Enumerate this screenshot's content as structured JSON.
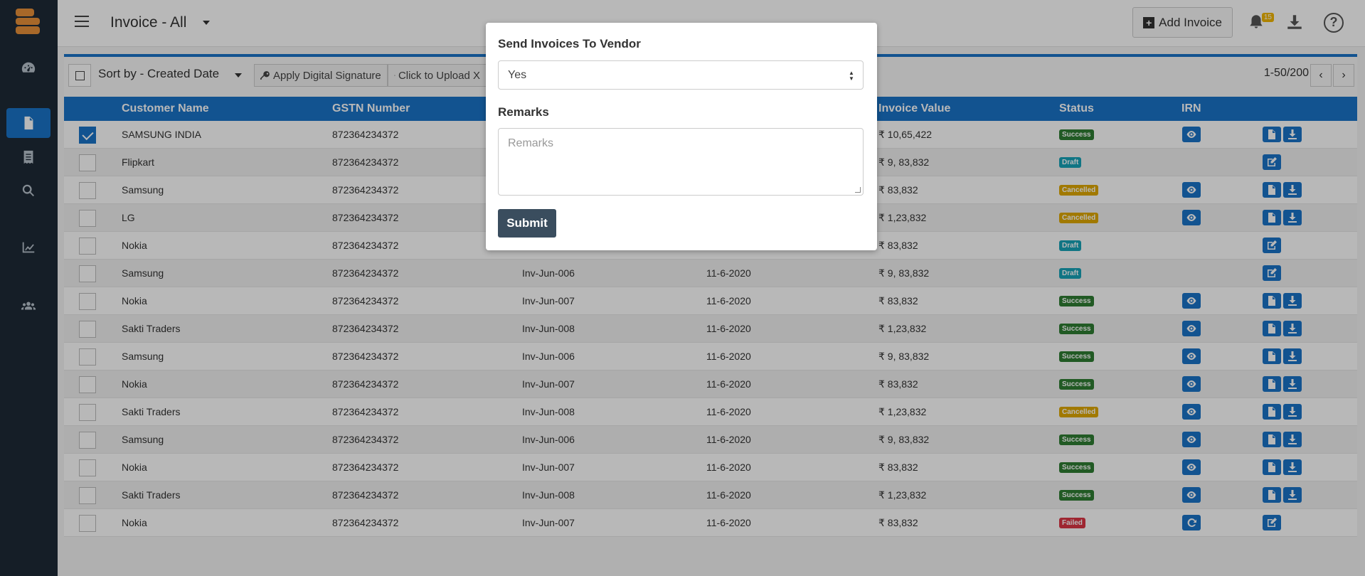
{
  "header": {
    "title": "Invoice - All",
    "add_invoice": "Add Invoice",
    "notification_count": "15"
  },
  "toolbar": {
    "sort_label": "Sort by - Created Date",
    "apply_signature": "Apply Digital Signature",
    "upload": "Click to Upload X",
    "pagination": "1-50/200"
  },
  "table": {
    "columns": [
      "Customer Name",
      "GSTN Number",
      "Invoice Value",
      "Status",
      "IRN"
    ],
    "rows": [
      {
        "checked": true,
        "name": "SAMSUNG INDIA",
        "gstn": "872364234372",
        "invoice": "",
        "date": "",
        "value": "₹ 10,65,422",
        "status": "Success",
        "irn": "view",
        "actions": [
          "doc",
          "download"
        ]
      },
      {
        "checked": false,
        "name": "Flipkart",
        "gstn": "872364234372",
        "invoice": "",
        "date": "",
        "value": "₹ 9, 83,832",
        "status": "Draft",
        "irn": "",
        "actions": [
          "edit"
        ]
      },
      {
        "checked": false,
        "name": "Samsung",
        "gstn": "872364234372",
        "invoice": "",
        "date": "",
        "value": "₹ 83,832",
        "status": "Cancelled",
        "irn": "view",
        "actions": [
          "doc",
          "download"
        ]
      },
      {
        "checked": false,
        "name": "LG",
        "gstn": "872364234372",
        "invoice": "",
        "date": "",
        "value": "₹ 1,23,832",
        "status": "Cancelled",
        "irn": "view",
        "actions": [
          "doc",
          "download"
        ]
      },
      {
        "checked": false,
        "name": "Nokia",
        "gstn": "872364234372",
        "invoice": "",
        "date": "",
        "value": "₹ 83,832",
        "status": "Draft",
        "irn": "",
        "actions": [
          "edit"
        ]
      },
      {
        "checked": false,
        "name": "Samsung",
        "gstn": "872364234372",
        "invoice": "Inv-Jun-006",
        "date": "11-6-2020",
        "value": "₹ 9, 83,832",
        "status": "Draft",
        "irn": "",
        "actions": [
          "edit"
        ]
      },
      {
        "checked": false,
        "name": "Nokia",
        "gstn": "872364234372",
        "invoice": "Inv-Jun-007",
        "date": "11-6-2020",
        "value": "₹ 83,832",
        "status": "Success",
        "irn": "view",
        "actions": [
          "doc",
          "download"
        ]
      },
      {
        "checked": false,
        "name": "Sakti Traders",
        "gstn": "872364234372",
        "invoice": "Inv-Jun-008",
        "date": "11-6-2020",
        "value": "₹ 1,23,832",
        "status": "Success",
        "irn": "view",
        "actions": [
          "doc",
          "download"
        ]
      },
      {
        "checked": false,
        "name": "Samsung",
        "gstn": "872364234372",
        "invoice": "Inv-Jun-006",
        "date": "11-6-2020",
        "value": "₹ 9, 83,832",
        "status": "Success",
        "irn": "view",
        "actions": [
          "doc",
          "download"
        ]
      },
      {
        "checked": false,
        "name": "Nokia",
        "gstn": "872364234372",
        "invoice": "Inv-Jun-007",
        "date": "11-6-2020",
        "value": "₹ 83,832",
        "status": "Success",
        "irn": "view",
        "actions": [
          "doc",
          "download"
        ]
      },
      {
        "checked": false,
        "name": "Sakti Traders",
        "gstn": "872364234372",
        "invoice": "Inv-Jun-008",
        "date": "11-6-2020",
        "value": "₹ 1,23,832",
        "status": "Cancelled",
        "irn": "view",
        "actions": [
          "doc",
          "download"
        ]
      },
      {
        "checked": false,
        "name": "Samsung",
        "gstn": "872364234372",
        "invoice": "Inv-Jun-006",
        "date": "11-6-2020",
        "value": "₹ 9, 83,832",
        "status": "Success",
        "irn": "view",
        "actions": [
          "doc",
          "download"
        ]
      },
      {
        "checked": false,
        "name": "Nokia",
        "gstn": "872364234372",
        "invoice": "Inv-Jun-007",
        "date": "11-6-2020",
        "value": "₹ 83,832",
        "status": "Success",
        "irn": "view",
        "actions": [
          "doc",
          "download"
        ]
      },
      {
        "checked": false,
        "name": "Sakti Traders",
        "gstn": "872364234372",
        "invoice": "Inv-Jun-008",
        "date": "11-6-2020",
        "value": "₹ 1,23,832",
        "status": "Success",
        "irn": "view",
        "actions": [
          "doc",
          "download"
        ]
      },
      {
        "checked": false,
        "name": "Nokia",
        "gstn": "872364234372",
        "invoice": "Inv-Jun-007",
        "date": "11-6-2020",
        "value": "₹ 83,832",
        "status": "Failed",
        "irn": "refresh",
        "actions": [
          "edit"
        ]
      }
    ]
  },
  "status_colors": {
    "Success": "#2e7d32",
    "Draft": "#17a2b8",
    "Cancelled": "#e0a800",
    "Failed": "#dc3545"
  },
  "modal": {
    "title": "Send Invoices To Vendor",
    "select_value": "Yes",
    "remarks_label": "Remarks",
    "remarks_placeholder": "Remarks",
    "submit": "Submit"
  }
}
